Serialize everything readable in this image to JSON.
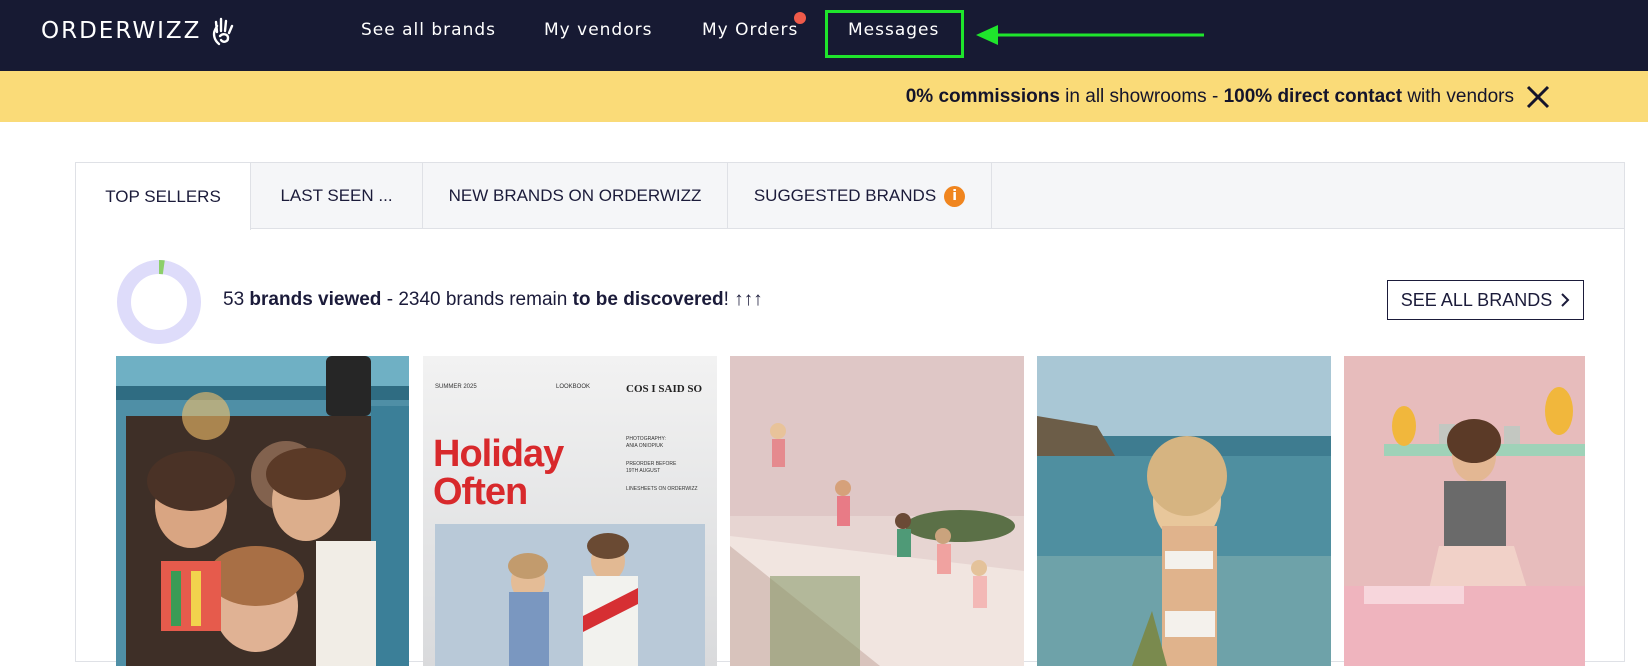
{
  "nav": {
    "logo_text": "ORDERWIZZ",
    "items": [
      {
        "label": "See all brands"
      },
      {
        "label": "My vendors"
      },
      {
        "label": "My Orders"
      },
      {
        "label": "Messages"
      }
    ]
  },
  "banner": {
    "part1": "0% commissions",
    "part2": " in all showrooms - ",
    "part3": "100% direct contact",
    "part4": " with vendors"
  },
  "tabs": [
    {
      "label": "TOP SELLERS"
    },
    {
      "label": "LAST SEEN ..."
    },
    {
      "label": "NEW BRANDS ON ORDERWIZZ"
    },
    {
      "label": "SUGGESTED BRANDS"
    }
  ],
  "info_badge": "i",
  "stats": {
    "viewed_count": "53",
    "viewed_label": "brands viewed",
    "sep": " - ",
    "remain_text": "2340 brands remain ",
    "discover_label": "to be discovered",
    "tail": "! ↑↑↑",
    "progress_fraction": 0.022
  },
  "see_all_button": "SEE ALL BRANDS",
  "lookbook": {
    "season": "SUMMER 2025",
    "kind": "LOOKBOOK",
    "brand": "COS I SAID SO",
    "title_line1": "Holiday",
    "title_line2": "Often",
    "credit1": "PHOTOGRAPHY:",
    "credit2": "ANIA ONIOPIUK",
    "preorder1": "PREORDER BEFORE",
    "preorder2": "19TH AUGUST",
    "linesheets": "LINESHEETS ON ORDERWIZZ"
  },
  "colors": {
    "nav_bg": "#171a33",
    "banner_bg": "#fadb78",
    "highlight": "#1fe52c",
    "notification_dot": "#ef5a4a",
    "info_badge": "#f0851f",
    "donut_track": "#dedcfa",
    "donut_fill": "#8ccf6a"
  }
}
